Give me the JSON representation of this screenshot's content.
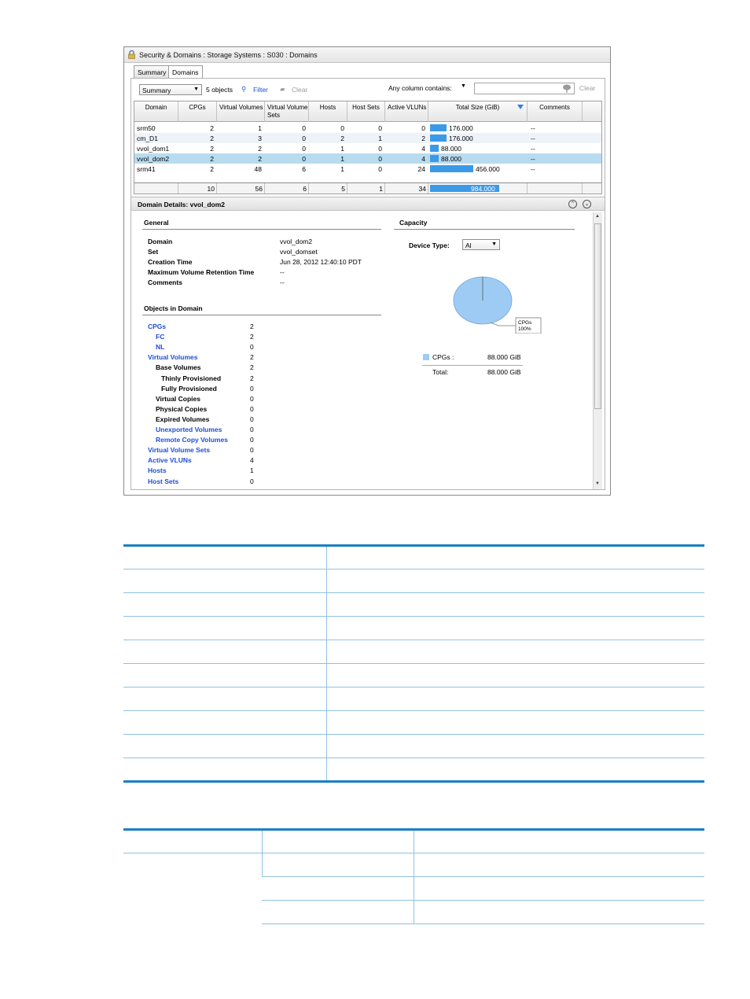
{
  "window": {
    "title": "Security & Domains : Storage Systems : S030 : Domains"
  },
  "tabs": [
    {
      "label": "Summary",
      "active": false
    },
    {
      "label": "Domains",
      "active": true
    }
  ],
  "filterbar": {
    "view_select": "Summary",
    "object_count": "5 objects",
    "filter_label": "Filter",
    "clear_label": "Clear",
    "any_column_label": "Any column contains:",
    "search_value": "",
    "search_clear_label": "Clear"
  },
  "table": {
    "columns": [
      "Domain",
      "CPGs",
      "Virtual Volumes",
      "Virtual Volume Sets",
      "Hosts",
      "Host Sets",
      "Active VLUNs",
      "Total Size (GiB)",
      "Comments"
    ],
    "rows": [
      {
        "domain": "srm50",
        "cpgs": "2",
        "vv": "1",
        "vvs": "0",
        "hosts": "0",
        "host_sets": "0",
        "vluns": "0",
        "size": "176.000",
        "size_fraction": 0.179,
        "comments": "--"
      },
      {
        "domain": "cm_D1",
        "cpgs": "2",
        "vv": "3",
        "vvs": "0",
        "hosts": "2",
        "host_sets": "1",
        "vluns": "2",
        "size": "176.000",
        "size_fraction": 0.179,
        "comments": "--"
      },
      {
        "domain": "vvol_dom1",
        "cpgs": "2",
        "vv": "2",
        "vvs": "0",
        "hosts": "1",
        "host_sets": "0",
        "vluns": "4",
        "size": "88.000",
        "size_fraction": 0.089,
        "comments": "--"
      },
      {
        "domain": "vvol_dom2",
        "cpgs": "2",
        "vv": "2",
        "vvs": "0",
        "hosts": "1",
        "host_sets": "0",
        "vluns": "4",
        "size": "88.000",
        "size_fraction": 0.089,
        "comments": "--",
        "selected": true
      },
      {
        "domain": "srm41",
        "cpgs": "2",
        "vv": "48",
        "vvs": "6",
        "hosts": "1",
        "host_sets": "0",
        "vluns": "24",
        "size": "456.000",
        "size_fraction": 0.463,
        "comments": "--"
      }
    ],
    "totals": {
      "cpgs": "10",
      "vv": "56",
      "vvs": "6",
      "hosts": "5",
      "host_sets": "1",
      "vluns": "34",
      "size": "984.000",
      "size_fraction": 1.0
    }
  },
  "details": {
    "title": "Domain Details: vvol_dom2",
    "general": {
      "heading": "General",
      "fields": [
        {
          "label": "Domain",
          "value": "vvol_dom2"
        },
        {
          "label": "Set",
          "value": "vvol_domset"
        },
        {
          "label": "Creation Time",
          "value": "Jun 28, 2012 12:40:10 PDT"
        },
        {
          "label": "Maximum Volume Retention Time",
          "value": "--"
        },
        {
          "label": "Comments",
          "value": "--"
        }
      ]
    },
    "objects": {
      "heading": "Objects in Domain",
      "items": [
        {
          "label": "CPGs",
          "value": "2",
          "link": true,
          "indent": 0
        },
        {
          "label": "FC",
          "value": "2",
          "link": true,
          "indent": 1
        },
        {
          "label": "NL",
          "value": "0",
          "link": true,
          "indent": 1
        },
        {
          "label": "Virtual Volumes",
          "value": "2",
          "link": true,
          "indent": 0
        },
        {
          "label": "Base Volumes",
          "value": "2",
          "link": false,
          "indent": 1
        },
        {
          "label": "Thinly Provisioned",
          "value": "2",
          "link": false,
          "indent": 2
        },
        {
          "label": "Fully Provisioned",
          "value": "0",
          "link": false,
          "indent": 2
        },
        {
          "label": "Virtual Copies",
          "value": "0",
          "link": false,
          "indent": 1
        },
        {
          "label": "Physical Copies",
          "value": "0",
          "link": false,
          "indent": 1
        },
        {
          "label": "Expired Volumes",
          "value": "0",
          "link": false,
          "indent": 1
        },
        {
          "label": "Unexported Volumes",
          "value": "0",
          "link": true,
          "indent": 1
        },
        {
          "label": "Remote Copy Volumes",
          "value": "0",
          "link": true,
          "indent": 1
        },
        {
          "label": "Virtual Volume Sets",
          "value": "0",
          "link": true,
          "indent": 0
        },
        {
          "label": "Active VLUNs",
          "value": "4",
          "link": true,
          "indent": 0
        },
        {
          "label": "Hosts",
          "value": "1",
          "link": true,
          "indent": 0
        },
        {
          "label": "Host Sets",
          "value": "0",
          "link": true,
          "indent": 0
        }
      ]
    },
    "capacity": {
      "heading": "Capacity",
      "device_type_label": "Device Type:",
      "device_type_value": "Al",
      "pie_label_name": "CPGs",
      "pie_label_pct": "100%",
      "legend": [
        {
          "label": "CPGs :",
          "value": "88.000 GiB",
          "color": "#9ecbf4"
        }
      ],
      "total_label": "Total:",
      "total_value": "88.000 GiB"
    }
  },
  "colors": {
    "bar": "#3b9ae8",
    "link": "#1d4fd6",
    "selected_row": "#b8dcef",
    "pie": "#9ecbf4",
    "table_rule": "#8fc2e0"
  }
}
